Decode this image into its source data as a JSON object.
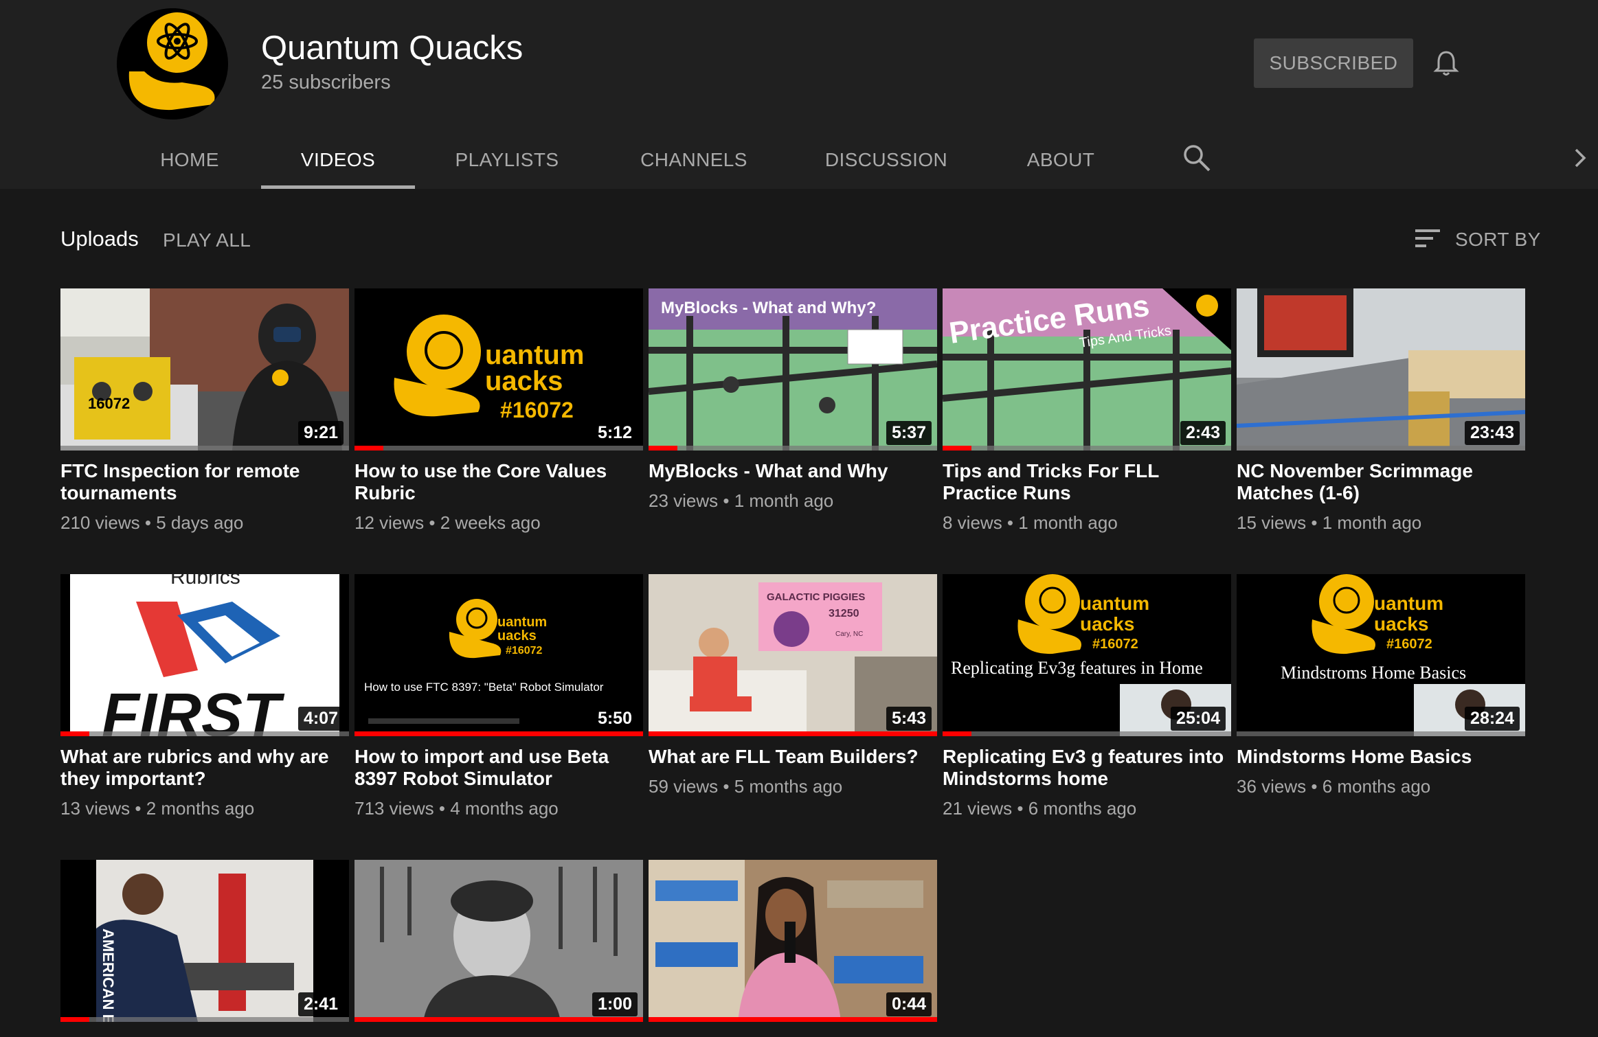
{
  "channel": {
    "name": "Quantum Quacks",
    "subscribers": "25 subscribers",
    "subscribe_label": "SUBSCRIBED"
  },
  "tabs": [
    {
      "label": "HOME"
    },
    {
      "label": "VIDEOS",
      "active": true
    },
    {
      "label": "PLAYLISTS"
    },
    {
      "label": "CHANNELS"
    },
    {
      "label": "DISCUSSION"
    },
    {
      "label": "ABOUT"
    }
  ],
  "icons": {
    "bell": "bell-icon",
    "search": "search-icon",
    "next": "chevron-right-icon",
    "sort": "sort-icon"
  },
  "uploads": {
    "title": "Uploads",
    "play_all": "PLAY ALL",
    "sort_by": "SORT BY"
  },
  "colors": {
    "background": "#181818",
    "header": "#202020",
    "brand_yellow": "#f5b800",
    "progress_red": "#ff0000"
  },
  "thumb_text": {
    "team_number": "#16072",
    "uantum": "uantum",
    "uacks": "uacks",
    "myblocks": "MyBlocks - What and Why?",
    "practice": "Practice Runs",
    "tips": "Tips And Tricks",
    "rubrics": "Rubrics",
    "first": "FIRST",
    "beta": "How to use FTC 8397: \"Beta\" Robot Simulator",
    "galactic": "GALACTIC PIGGIES",
    "galactic_num": "31250",
    "galactic_loc": "Cary, NC",
    "ev3": "Replicating Ev3g features in Home",
    "mind": "Mindstroms Home Basics",
    "robot_number": "16072",
    "eagle": "AMERICAN EAGLE"
  },
  "videos": [
    {
      "title": "FTC Inspection for remote tournaments",
      "duration": "9:21",
      "views": "210 views",
      "age": "5 days ago",
      "watched": 0
    },
    {
      "title": "How to use the Core Values Rubric",
      "duration": "5:12",
      "views": "12 views",
      "age": "2 weeks ago",
      "watched": 0.1
    },
    {
      "title": "MyBlocks - What and Why",
      "duration": "5:37",
      "views": "23 views",
      "age": "1 month ago",
      "watched": 0.1
    },
    {
      "title": "Tips and Tricks For FLL Practice Runs",
      "duration": "2:43",
      "views": "8 views",
      "age": "1 month ago",
      "watched": 0.1
    },
    {
      "title": "NC November Scrimmage Matches (1-6)",
      "duration": "23:43",
      "views": "15 views",
      "age": "1 month ago",
      "watched": 0
    },
    {
      "title": "What are rubrics and why are they important?",
      "duration": "4:07",
      "views": "13 views",
      "age": "2 months ago",
      "watched": 0.1
    },
    {
      "title": "How to import and use Beta 8397 Robot Simulator",
      "duration": "5:50",
      "views": "713 views",
      "age": "4 months ago",
      "watched": 1
    },
    {
      "title": "What are FLL Team Builders?",
      "duration": "5:43",
      "views": "59 views",
      "age": "5 months ago",
      "watched": 1
    },
    {
      "title": "Replicating Ev3 g features into Mindstorms home",
      "duration": "25:04",
      "views": "21 views",
      "age": "6 months ago",
      "watched": 0.1
    },
    {
      "title": "Mindstorms Home Basics",
      "duration": "28:24",
      "views": "36 views",
      "age": "6 months ago",
      "watched": 0
    },
    {
      "title": "",
      "duration": "2:41",
      "views": "",
      "age": "",
      "watched": 0.1
    },
    {
      "title": "",
      "duration": "1:00",
      "views": "",
      "age": "",
      "watched": 1
    },
    {
      "title": "",
      "duration": "0:44",
      "views": "",
      "age": "",
      "watched": 1
    }
  ]
}
